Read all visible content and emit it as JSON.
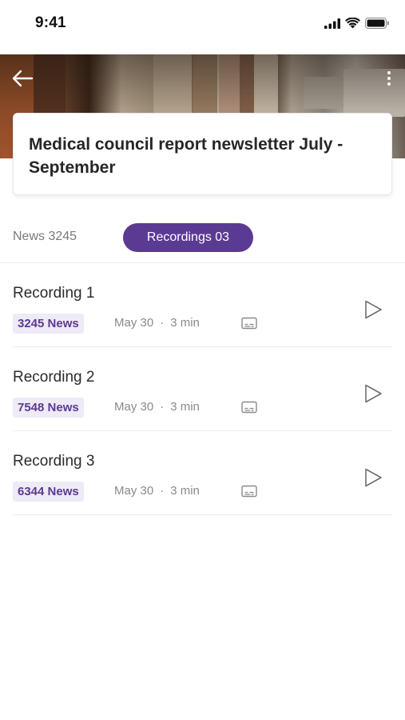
{
  "status_bar": {
    "time": "9:41"
  },
  "header": {
    "title": "Medical council report newsletter July - September"
  },
  "tabs": {
    "news_label": "News 3245",
    "recordings_label": "Recordings 03",
    "active": "recordings"
  },
  "recordings": [
    {
      "title": "Recording 1",
      "badge": "3245 News",
      "date": "May 30",
      "separator": "·",
      "duration": "3 min"
    },
    {
      "title": "Recording 2",
      "badge": "7548 News",
      "date": "May 30",
      "separator": "·",
      "duration": "3 min"
    },
    {
      "title": "Recording 3",
      "badge": "6344 News",
      "date": "May 30",
      "separator": "·",
      "duration": "3 min"
    }
  ],
  "icons": {
    "back": "arrow-left-icon",
    "more": "more-vertical-icon",
    "captions": "closed-captions-icon",
    "play": "play-icon"
  },
  "colors": {
    "accent": "#5b3a93",
    "badge_bg": "#eeeaf6",
    "text_primary": "#2b2b2b",
    "text_secondary": "#8a8a8a"
  }
}
